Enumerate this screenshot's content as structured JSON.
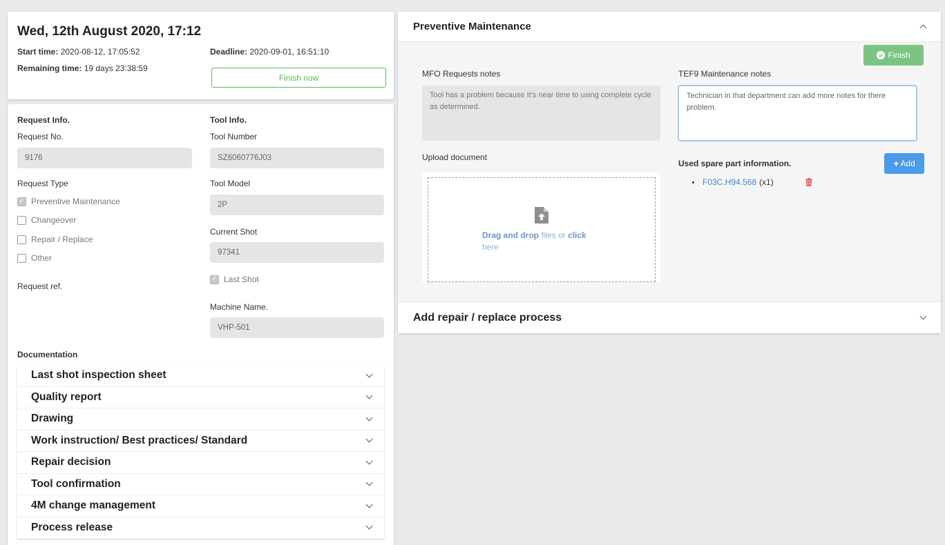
{
  "header": {
    "datetime": "Wed, 12th August 2020, 17:12",
    "start_label": "Start time:",
    "start_value": "2020-08-12, 17:05:52",
    "deadline_label": "Deadline:",
    "deadline_value": "2020-09-01, 16:51:10",
    "remaining_label": "Remaining time:",
    "remaining_value": "19 days 23:38:59",
    "finish_now": "Finish now"
  },
  "request": {
    "section_title": "Request Info.",
    "no_label": "Request No.",
    "no_value": "9176",
    "type_label": "Request Type",
    "types": [
      {
        "label": "Preventive Maintenance",
        "checked": true
      },
      {
        "label": "Changeover",
        "checked": false
      },
      {
        "label": "Repair / Replace",
        "checked": false
      },
      {
        "label": "Other",
        "checked": false
      }
    ],
    "ref_label": "Request ref."
  },
  "tool": {
    "section_title": "Tool Info.",
    "number_label": "Tool Number",
    "number_value": "SZ6060776J03",
    "model_label": "Tool Model",
    "model_value": "2P",
    "shot_label": "Current Shot",
    "shot_value": "97341",
    "last_shot_label": "Last Shot",
    "machine_label": "Machine Name.",
    "machine_value": "VHP-501"
  },
  "documentation": {
    "title": "Documentation",
    "items": [
      "Last shot inspection sheet",
      "Quality report",
      "Drawing",
      "Work instruction/ Best practices/ Standard",
      "Repair decision",
      "Tool confirmation",
      "4M change management",
      "Process release"
    ]
  },
  "pm": {
    "title": "Preventive Maintenance",
    "finish": "Finish",
    "mfo_label": "MFO Requests notes",
    "mfo_text": "Tool has a problem because It's near time to using complete cycle as determined.",
    "tef_label": "TEF9 Maintenance notes",
    "tef_text": "Technician in that department can add more notes for there problem.",
    "upload_label": "Upload document",
    "dz_bold1": "Drag and drop",
    "dz_mid": " files or ",
    "dz_bold2": "click",
    "dz_end": "here",
    "spare_label": "Used spare part information.",
    "add": "Add",
    "spare_part": "F03C.H94.568",
    "spare_qty": "(x1)"
  },
  "repair": {
    "title": "Add repair / replace process"
  },
  "colors": {
    "green": "#5cb85c",
    "blue": "#4a9be8",
    "link": "#3a8ad4",
    "danger": "#e05656"
  }
}
